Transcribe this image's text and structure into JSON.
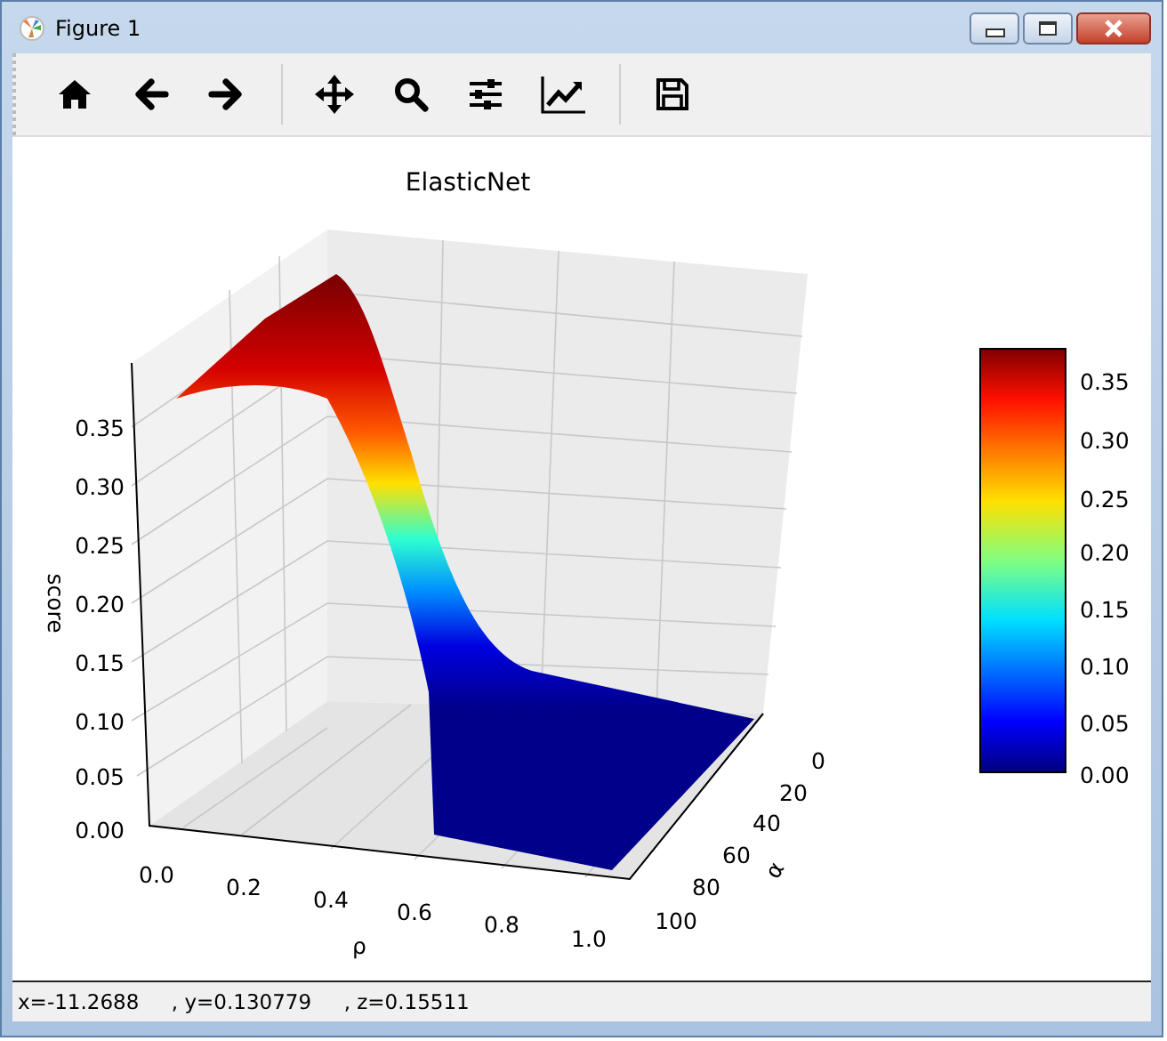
{
  "window": {
    "title": "Figure 1"
  },
  "plot": {
    "title": "ElasticNet",
    "zlabel": "score",
    "xlabel": "ρ",
    "ylabel": "α",
    "zticks": [
      "0.35",
      "0.30",
      "0.25",
      "0.20",
      "0.15",
      "0.10",
      "0.05",
      "0.00"
    ],
    "xticks": [
      "0.0",
      "0.2",
      "0.4",
      "0.6",
      "0.8",
      "1.0"
    ],
    "yticks": [
      "0",
      "20",
      "40",
      "60",
      "80",
      "100"
    ]
  },
  "colorbar": {
    "ticks": [
      "0.35",
      "0.30",
      "0.25",
      "0.20",
      "0.15",
      "0.10",
      "0.05",
      "0.00"
    ]
  },
  "status_bar": {
    "text": "x=-11.2688     , y=0.130779     , z=0.15511"
  }
}
